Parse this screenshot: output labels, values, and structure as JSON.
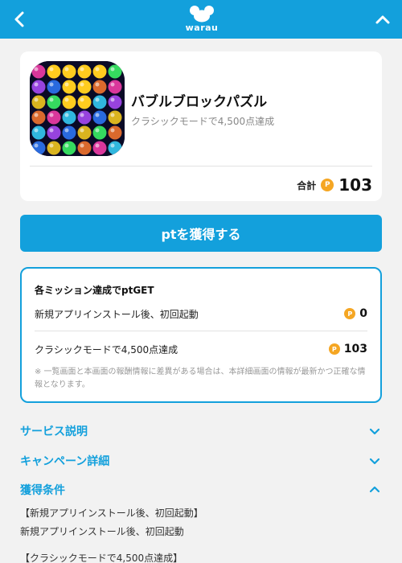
{
  "header": {
    "brand": "warau",
    "back_icon": "chevron-left-icon",
    "collapse_icon": "chevron-up-icon",
    "color": "#13a0dc"
  },
  "app": {
    "title": "バブルブロックパズル",
    "subtitle": "クラシックモードで4,500点達成",
    "total_label": "合計",
    "coin_symbol": "P",
    "total_points": "103"
  },
  "cta": {
    "label": "ptを獲得する"
  },
  "missions": {
    "heading": "各ミッション達成でptGET",
    "items": [
      {
        "label": "新規アプリインストール後、初回起動",
        "points": "0"
      },
      {
        "label": "クラシックモードで4,500点達成",
        "points": "103"
      }
    ],
    "note": "※ 一覧画面と本画面の報酬情報に差異がある場合は、本詳細画面の情報が最新かつ正確な情報となります。"
  },
  "sections": [
    {
      "title": "サービス説明",
      "state": "collapsed"
    },
    {
      "title": "キャンペーン詳細",
      "state": "collapsed"
    },
    {
      "title": "獲得条件",
      "state": "expanded"
    }
  ],
  "conditions": {
    "lines": [
      "【新規アプリインストール後、初回起動】",
      "新規アプリインストール後、初回起動",
      "【クラシックモードで4,500点達成】"
    ]
  },
  "colors": {
    "accent": "#13a0dc",
    "coin": "#f5a623",
    "background": "#f2f2f2"
  }
}
